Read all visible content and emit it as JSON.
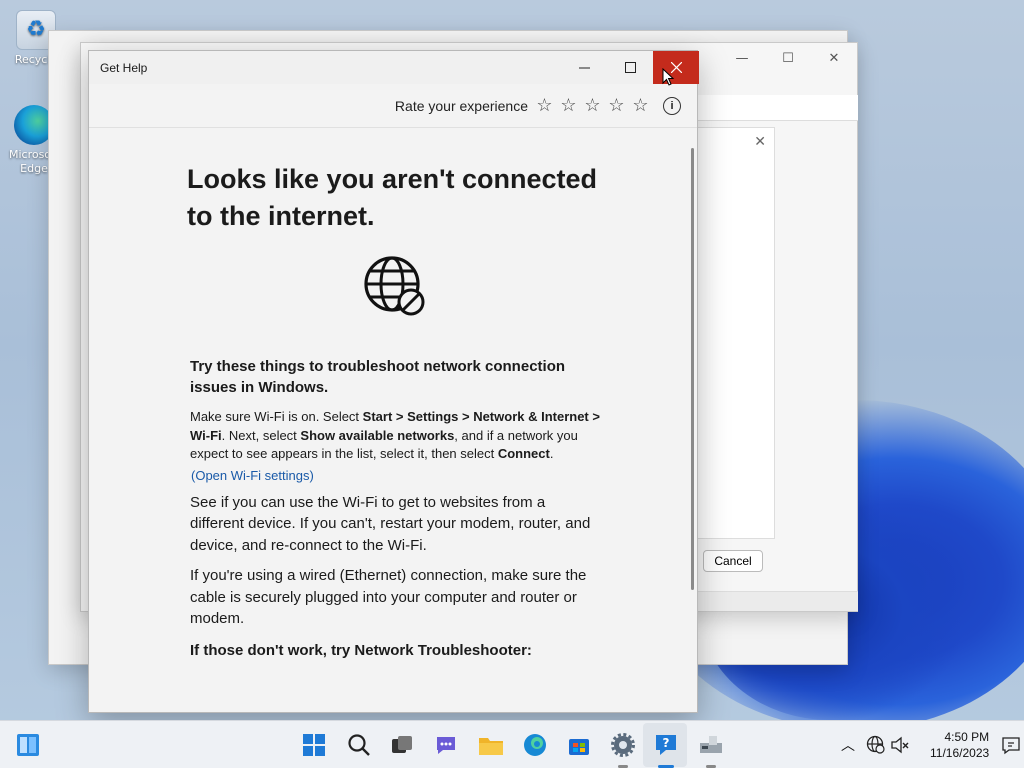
{
  "desktop": {
    "icons": [
      {
        "label": "Recycle"
      },
      {
        "label": "Microsoft Edge"
      }
    ]
  },
  "bg_window": {
    "cancel_label": "Cancel"
  },
  "dialog": {
    "title": "Get Help",
    "rate_label": "Rate your experience",
    "stars": [
      "☆",
      "☆",
      "☆",
      "☆",
      "☆"
    ],
    "info_glyph": "i",
    "heading": "Looks like you aren't connected to the internet.",
    "troubleshoot_heading": "Try these things to troubleshoot network connection issues in Windows.",
    "wifi_text": {
      "a": "Make sure Wi-Fi is on. Select ",
      "b": "Start > Settings > Network & Internet > Wi-Fi",
      "c": ". Next, select ",
      "d": "Show available networks",
      "e": ", and if a network you expect to see appears in the list, select it, then select ",
      "f": "Connect",
      "g": "."
    },
    "wifi_link": "(Open Wi-Fi settings)",
    "other_device_text": "See if you can use the Wi-Fi to get to websites from a different device. If you can't, restart your modem, router, and device, and re-connect to the Wi-Fi.",
    "wired_text": "If you're using a wired (Ethernet) connection, make sure the cable is securely plugged into your computer and router or modem.",
    "final_heading": "If those don't work, try Network Troubleshooter:"
  },
  "taskbar": {
    "time": "4:50 PM",
    "date": "11/16/2023"
  }
}
